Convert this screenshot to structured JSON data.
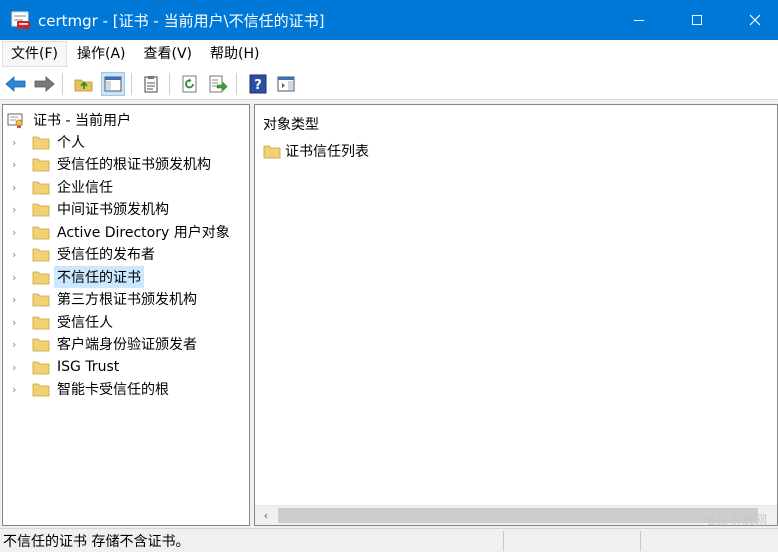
{
  "window": {
    "title": "certmgr - [证书 - 当前用户\\不信任的证书]",
    "controls": {
      "minimize": "minimize-icon",
      "maximize": "maximize-icon",
      "close": "close-icon"
    },
    "accent": "#0078d7"
  },
  "menu": [
    {
      "label": "文件(F)"
    },
    {
      "label": "操作(A)"
    },
    {
      "label": "查看(V)"
    },
    {
      "label": "帮助(H)"
    }
  ],
  "toolbar": {
    "icons": [
      "back-arrow-icon",
      "forward-arrow-icon",
      "up-folder-icon",
      "show-hide-console-tree-icon",
      "properties-icon",
      "refresh-icon",
      "export-list-icon",
      "help-icon",
      "show-hide-action-pane-icon"
    ]
  },
  "tree": {
    "root": "证书 - 当前用户",
    "items": [
      {
        "label": "个人"
      },
      {
        "label": "受信任的根证书颁发机构"
      },
      {
        "label": "企业信任"
      },
      {
        "label": "中间证书颁发机构"
      },
      {
        "label": "Active Directory 用户对象"
      },
      {
        "label": "受信任的发布者"
      },
      {
        "label": "不信任的证书",
        "selected": true
      },
      {
        "label": "第三方根证书颁发机构"
      },
      {
        "label": "受信任人"
      },
      {
        "label": "客户端身份验证颁发者"
      },
      {
        "label": "ISG Trust"
      },
      {
        "label": "智能卡受信任的根"
      }
    ]
  },
  "details": {
    "column_header": "对象类型",
    "items": [
      {
        "label": "证书信任列表"
      }
    ]
  },
  "status": {
    "text": "不信任的证书 存储不含证书。"
  },
  "watermark": "电脑系统网"
}
